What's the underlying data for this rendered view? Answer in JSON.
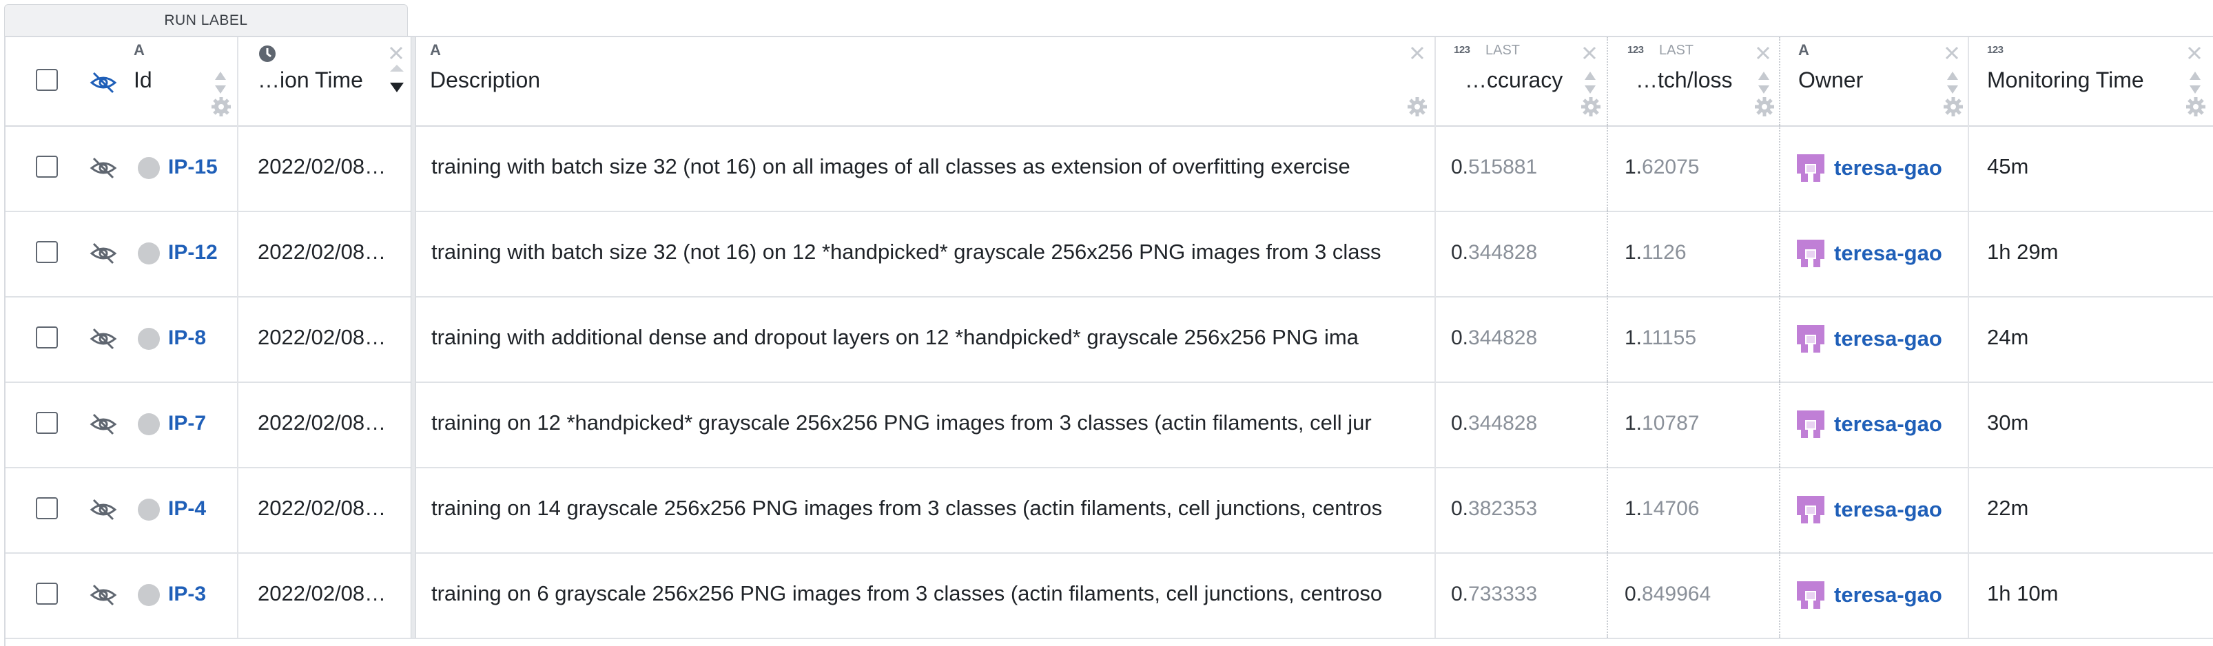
{
  "run_label_tab": "RUN LABEL",
  "columns": {
    "id": "Id",
    "creation_time": "…ion Time",
    "description": "Description",
    "accuracy": "…ccuracy",
    "batch_loss": "…tch/loss",
    "owner": "Owner",
    "monitoring_time": "Monitoring Time",
    "last_label": "LAST",
    "numeric_type_label": "123",
    "text_type_label": "A"
  },
  "rows": [
    {
      "id": "IP-15",
      "created": "2022/02/08…",
      "description": "training with batch size 32 (not 16) on all images of all classes as extension of overfitting exercise",
      "acc_lead": "0.",
      "acc_rest": "515881",
      "loss_lead": "1.",
      "loss_rest": "62075",
      "owner": "teresa-gao",
      "monitoring": "45m"
    },
    {
      "id": "IP-12",
      "created": "2022/02/08…",
      "description": "training with batch size 32 (not 16) on 12 *handpicked* grayscale 256x256 PNG images from 3 class",
      "acc_lead": "0.",
      "acc_rest": "344828",
      "loss_lead": "1.",
      "loss_rest": "1126",
      "owner": "teresa-gao",
      "monitoring": "1h 29m"
    },
    {
      "id": "IP-8",
      "created": "2022/02/08…",
      "description": "training with additional dense and dropout layers on 12 *handpicked* grayscale 256x256 PNG ima",
      "acc_lead": "0.",
      "acc_rest": "344828",
      "loss_lead": "1.",
      "loss_rest": "11155",
      "owner": "teresa-gao",
      "monitoring": "24m"
    },
    {
      "id": "IP-7",
      "created": "2022/02/08…",
      "description": "training on 12 *handpicked* grayscale 256x256 PNG images from 3 classes (actin filaments, cell jur",
      "acc_lead": "0.",
      "acc_rest": "344828",
      "loss_lead": "1.",
      "loss_rest": "10787",
      "owner": "teresa-gao",
      "monitoring": "30m"
    },
    {
      "id": "IP-4",
      "created": "2022/02/08…",
      "description": "training on 14 grayscale 256x256 PNG images from 3 classes (actin filaments, cell junctions, centros",
      "acc_lead": "0.",
      "acc_rest": "382353",
      "loss_lead": "1.",
      "loss_rest": "14706",
      "owner": "teresa-gao",
      "monitoring": "22m"
    },
    {
      "id": "IP-3",
      "created": "2022/02/08…",
      "description": "training on 6 grayscale 256x256 PNG images from 3 classes (actin filaments, cell junctions, centroso",
      "acc_lead": "0.",
      "acc_rest": "733333",
      "loss_lead": "0.",
      "loss_rest": "849964",
      "owner": "teresa-gao",
      "monitoring": "1h 10m"
    }
  ],
  "colors": {
    "link": "#1f5fb8",
    "avatar": "#c07fd6",
    "status_dot": "#c9cbce"
  }
}
